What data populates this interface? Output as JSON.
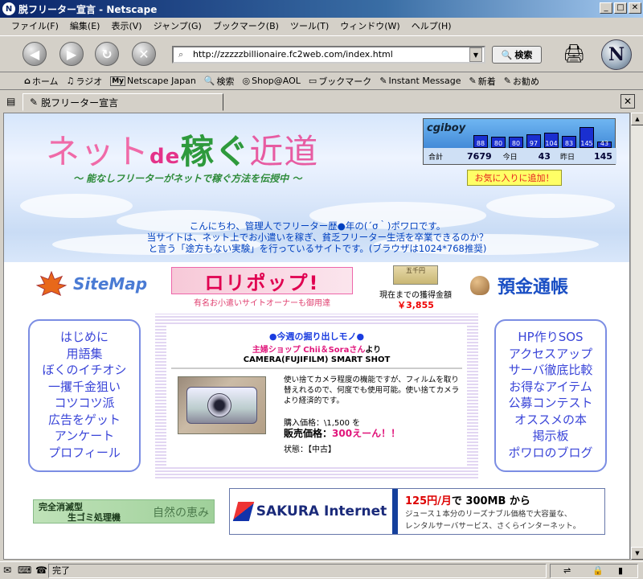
{
  "window": {
    "title": "脱フリーター宣言 - Netscape"
  },
  "menu": [
    "ファイル(F)",
    "編集(E)",
    "表示(V)",
    "ジャンプ(G)",
    "ブックマーク(B)",
    "ツール(T)",
    "ウィンドウ(W)",
    "ヘルプ(H)"
  ],
  "address": {
    "url": "http://zzzzzbillionaire.fc2web.com/index.html"
  },
  "search_label": "検索",
  "personal": [
    {
      "icon": "home-icon",
      "label": "ホーム"
    },
    {
      "icon": "radio-icon",
      "label": "ラジオ"
    },
    {
      "icon": "my-icon",
      "label": "Netscape Japan"
    },
    {
      "icon": "search-icon",
      "label": "検索"
    },
    {
      "icon": "aol-icon",
      "label": "Shop@AOL"
    },
    {
      "icon": "folder-icon",
      "label": "ブックマーク"
    },
    {
      "icon": "bookmark-icon",
      "label": "Instant Message"
    },
    {
      "icon": "bookmark-icon",
      "label": "新着"
    },
    {
      "icon": "bookmark-icon",
      "label": "お勧め"
    }
  ],
  "tab": {
    "label": "脱フリーター宣言"
  },
  "site": {
    "logo": {
      "part1": "ネット",
      "part2": "de",
      "part3": "稼ぐ",
      "part4": "近道"
    },
    "tagline": "～ 能なしフリーターがネットで稼ぐ方法を伝授中 ～",
    "counter": {
      "brand": "cgiboy",
      "days": [
        88,
        80,
        80,
        97,
        104,
        83,
        145,
        43
      ],
      "total_label": "合計",
      "total": "7679",
      "today_label": "今日",
      "today": "43",
      "yesterday_label": "昨日",
      "yesterday": "145"
    },
    "favorite_button": "お気に入りに追加！",
    "intro": [
      "こんにちわ、管理人でフリーター歴●年の(´σ｀)ポワロです。",
      "当サイトは、ネット上でお小遣いを稼ぎ、貧乏フリーター生活を卒業できるのか？",
      "と言う「途方もない実験」を行っているサイトです。(ブラウザは1024*768推奨)"
    ],
    "sitemap_label": "SiteMap",
    "lollipop": {
      "text": "ロリポップ!",
      "caption": "有名お小遣いサイトオーナーも御用達"
    },
    "earnings": {
      "bill_text": "五千円",
      "label": "現在までの獲得金額",
      "value": "￥3,855"
    },
    "deposit_label": "預金通帳",
    "left_nav": [
      "はじめに",
      "用語集",
      "ぼくのイチオシ",
      "一攫千金狙い",
      "コツコツ派",
      "広告をゲット",
      "アンケート",
      "プロフィール"
    ],
    "right_nav": [
      "HP作りSOS",
      "アクセスアップ",
      "サーバ徹底比較",
      "お得なアイテム",
      "公募コンテスト",
      "オススメの本",
      "掲示板",
      "ポワロのブログ"
    ],
    "feature": {
      "title": "●今週の掘り出しモノ●",
      "shop_prefix": "主婦ショップ",
      "shop_name": "Chii＆Soraさん",
      "shop_suffix": "より",
      "product": "CAMERA(FUJIFILM) SMART SHOT",
      "description": "使い捨てカメラ程度の機能ですが、フィルムを取り替えれるので、何度でも使用可能。使い捨てカメラより経済的です。",
      "buy_price": "購入価格：\\1,500 を",
      "sale_label": "販売価格：",
      "sale_value": "300えーん！！",
      "condition": "状態：【中古】"
    },
    "banner_gomi": {
      "line1": "完全消滅型",
      "line2": "生ゴミ処理機",
      "brand": "自然の恵み"
    },
    "sakura": {
      "name": "SAKURA Internet",
      "headline_price": "125円/月",
      "headline_rest": "で 300MB から",
      "desc1": "ジュース１本分のリーズナブル価格で大容量な、",
      "desc2": "レンタルサーバサービス、さくらインターネット。"
    }
  },
  "status": {
    "text": "完了"
  }
}
